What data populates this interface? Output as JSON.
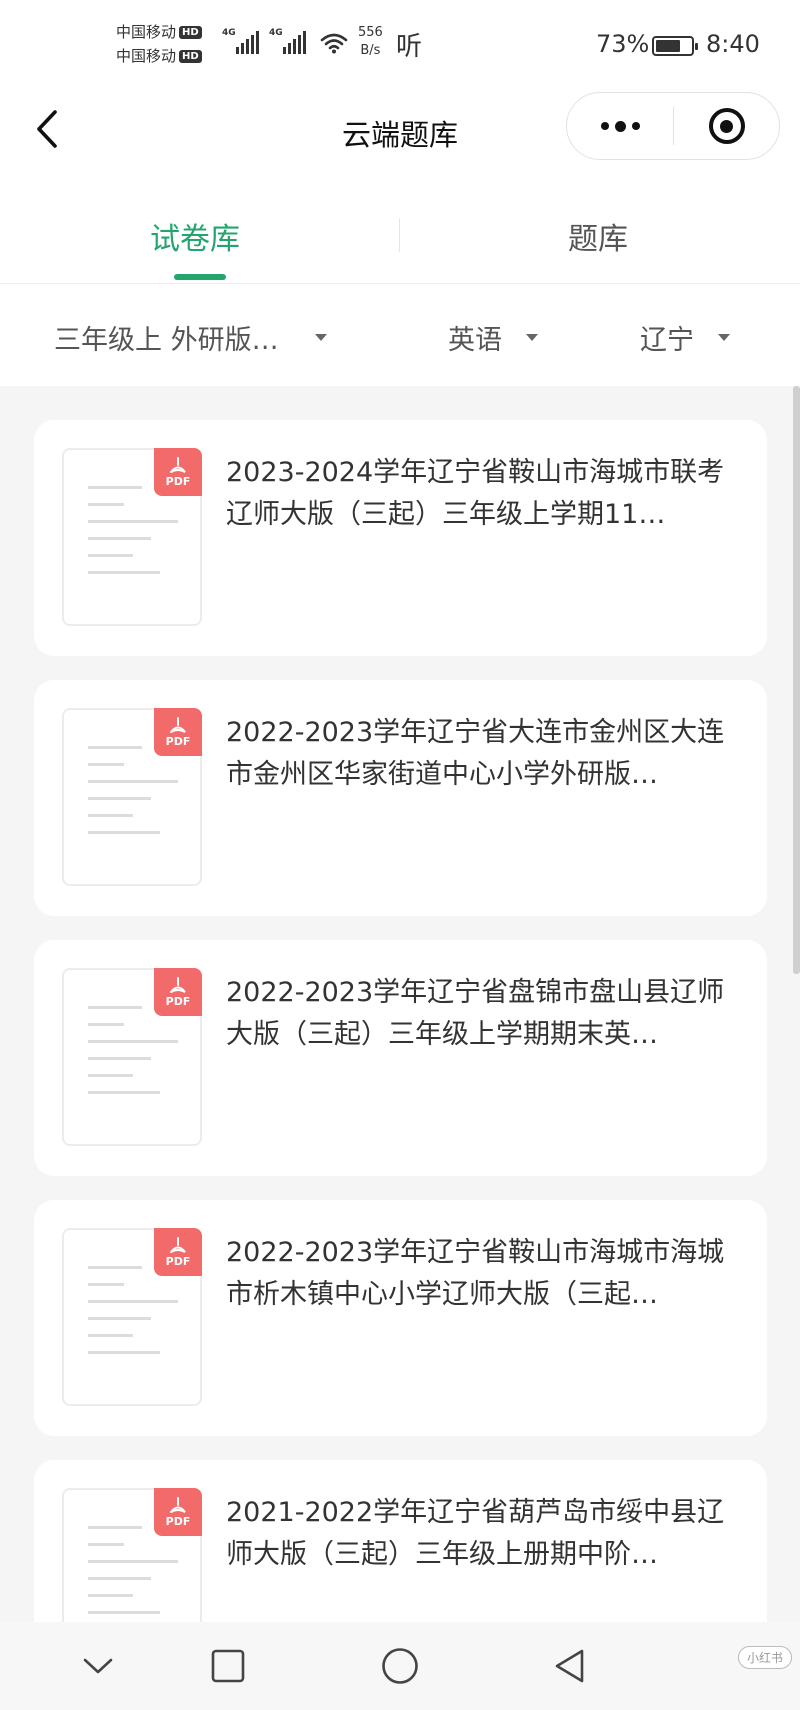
{
  "status_bar": {
    "carrier_1": "中国移动",
    "carrier_2": "中国移动",
    "hd": "HD",
    "network_1": "4G",
    "network_2": "4G",
    "speed_value": "556",
    "speed_unit": "B/s",
    "listen": "听",
    "battery_percent": "73%",
    "battery_level": 0.73,
    "time": "8:40"
  },
  "nav": {
    "title": "云端题库"
  },
  "tabs": [
    {
      "label": "试卷库",
      "active": true
    },
    {
      "label": "题库",
      "active": false
    }
  ],
  "filters": {
    "grade": "三年级上 外研版…",
    "subject": "英语",
    "region": "辽宁"
  },
  "papers": [
    {
      "badge": "PDF",
      "title": "2023-2024学年辽宁省鞍山市海城市联考辽师大版（三起）三年级上学期11…"
    },
    {
      "badge": "PDF",
      "title": "2022-2023学年辽宁省大连市金州区大连市金州区华家街道中心小学外研版…"
    },
    {
      "badge": "PDF",
      "title": "2022-2023学年辽宁省盘锦市盘山县辽师大版（三起）三年级上学期期末英…"
    },
    {
      "badge": "PDF",
      "title": "2022-2023学年辽宁省鞍山市海城市海城市析木镇中心小学辽师大版（三起…"
    },
    {
      "badge": "PDF",
      "title": "2021-2022学年辽宁省葫芦岛市绥中县辽师大版（三起）三年级上册期中阶…"
    }
  ],
  "watermark": {
    "badge": "小红书"
  },
  "colors": {
    "accent": "#24a46f",
    "pdf_badge": "#f26a6a"
  }
}
